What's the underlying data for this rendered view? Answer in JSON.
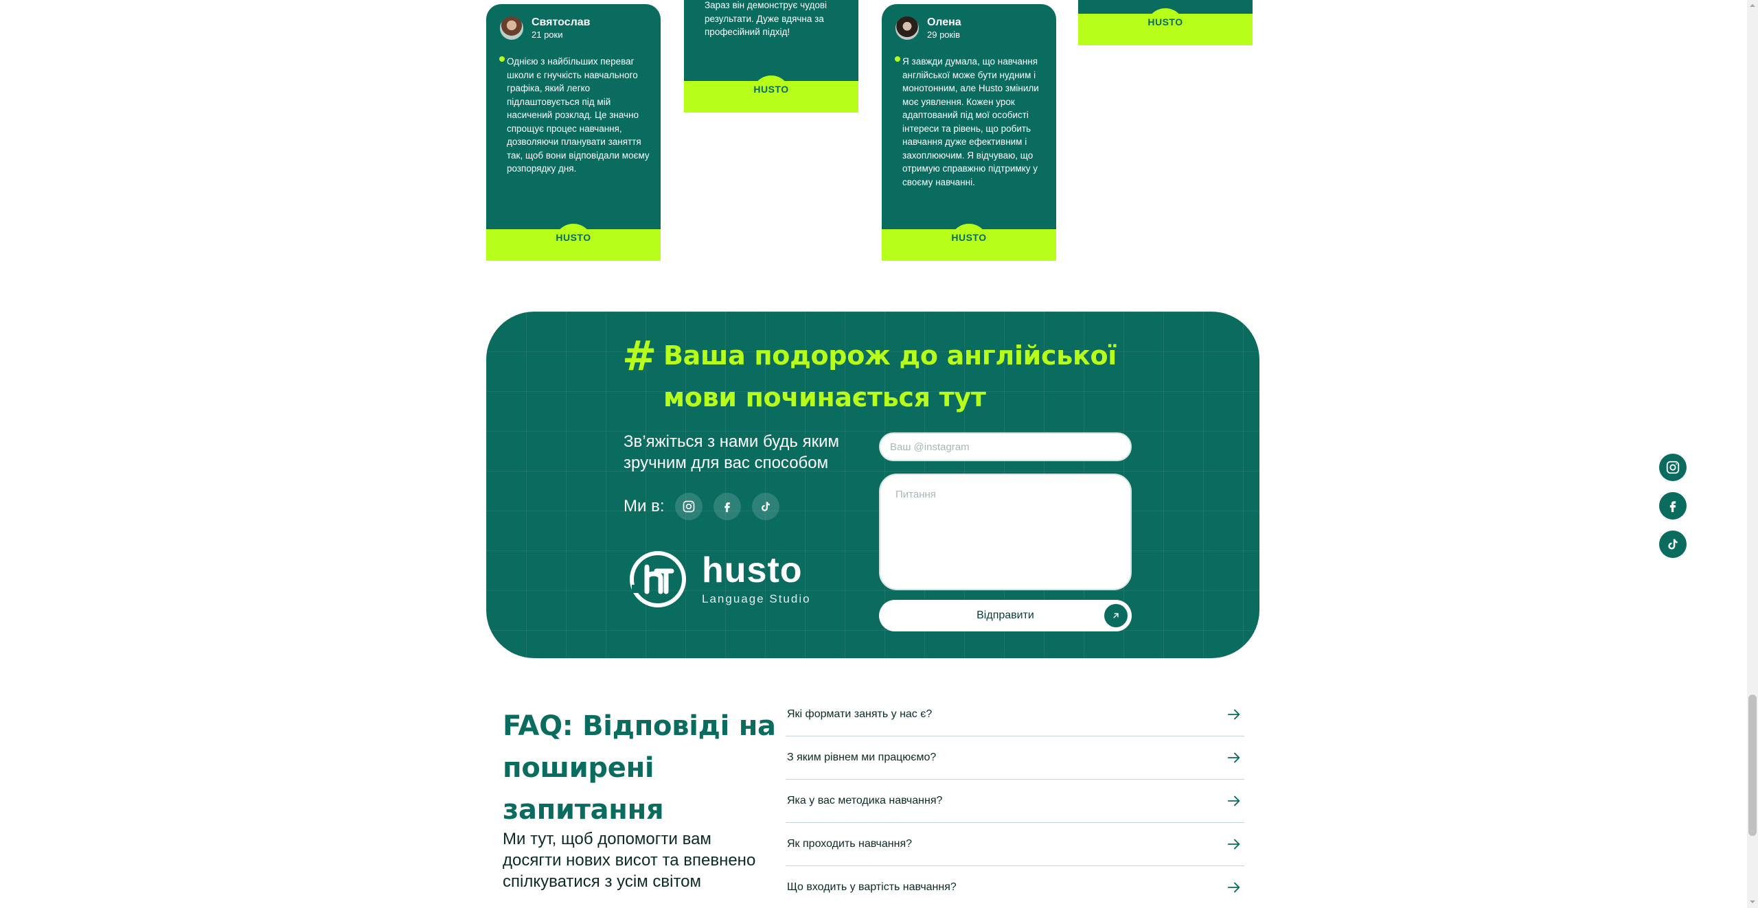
{
  "reviews": [
    {
      "name": "Святослав",
      "age": "21 роки",
      "quote": "Однією з найбільших переваг школи є гнучкість навчального графіка, який легко підлаштовується під мій насичений розклад. Це значно спрощує процес навчання, дозволяючи планувати заняття так, щоб вони відповідали моєму розпорядку дня.",
      "logo": "HUSTO"
    },
    {
      "name": "",
      "age": "",
      "quote": "Зараз він демонструє чудові результати. Дуже вдячна за професійний підхід!",
      "logo": "HUSTO"
    },
    {
      "name": "Олена",
      "age": "29 років",
      "quote": "Я завжди думала, що навчання англійської може бути нудним і монотонним, але Husto змінили моє уявлення. Кожен урок адаптований під мої особисті інтереси та рівень, що робить навчання дуже ефективним і захоплюючим. Я відчуваю, що отримую справжню підтримку  у своєму навчанні.",
      "logo": "HUSTO"
    },
    {
      "name": "",
      "age": "",
      "quote": "",
      "logo": "HUSTO"
    }
  ],
  "contact": {
    "hash": "#",
    "title": "Ваша подорож до англійської мови починається тут",
    "subtitle": "Зв’яжіться з нами будь яким зручним для вас способом",
    "we_in_label": "Ми в:",
    "brand_name": "husto",
    "brand_sub": "Language Studio",
    "instagram_placeholder": "Ваш @instagram",
    "question_placeholder": "Питання",
    "send_label": "Відправити"
  },
  "faq": {
    "title": "FAQ: Відповіді на поширені запитання",
    "subtitle": "Ми тут, щоб допомогти вам досягти нових висот та впевнено спілкуватися з усім світом",
    "questions": [
      "Які формати занять у нас є?",
      "З яким рівнем ми працюємо?",
      "Яка у вас методика навчання?",
      "Як проходить навчання?",
      "Що входить у вартість навчання?"
    ]
  },
  "colors": {
    "primary": "#0a6b5f",
    "accent": "#b7ff1a"
  },
  "icons": {
    "social": [
      "instagram-icon",
      "facebook-icon",
      "tiktok-icon"
    ],
    "faq_arrow": "arrow-right-icon",
    "send": "arrow-up-right-icon"
  }
}
